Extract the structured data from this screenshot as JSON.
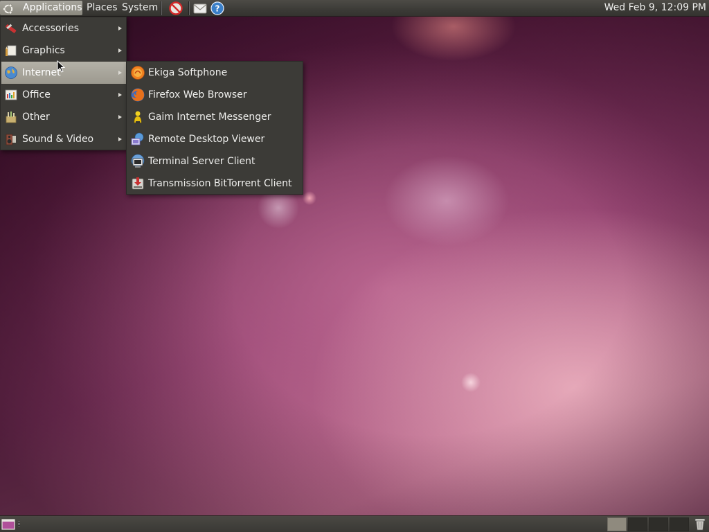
{
  "top_panel": {
    "menus": [
      {
        "label": "Applications"
      },
      {
        "label": "Places"
      },
      {
        "label": "System"
      }
    ],
    "launchers": {
      "disabled": "no-entry-icon",
      "mail": "mail-icon",
      "help": "help-icon"
    },
    "clock": "Wed Feb  9, 12:09 PM"
  },
  "applications_menu": {
    "items": [
      {
        "label": "Accessories",
        "icon": "accessories-icon"
      },
      {
        "label": "Graphics",
        "icon": "graphics-icon"
      },
      {
        "label": "Internet",
        "icon": "internet-icon"
      },
      {
        "label": "Office",
        "icon": "office-icon"
      },
      {
        "label": "Other",
        "icon": "other-icon"
      },
      {
        "label": "Sound & Video",
        "icon": "sound-video-icon"
      }
    ],
    "highlighted": "Internet"
  },
  "internet_submenu": {
    "items": [
      {
        "label": "Ekiga Softphone",
        "icon": "ekiga-icon"
      },
      {
        "label": "Firefox Web Browser",
        "icon": "firefox-icon"
      },
      {
        "label": "Gaim Internet Messenger",
        "icon": "gaim-icon"
      },
      {
        "label": "Remote Desktop Viewer",
        "icon": "remote-desktop-icon"
      },
      {
        "label": "Terminal Server Client",
        "icon": "terminal-server-icon"
      },
      {
        "label": "Transmission BitTorrent Client",
        "icon": "transmission-icon"
      }
    ]
  },
  "bottom_panel": {
    "workspaces": [
      {
        "active": true
      },
      {
        "active": false
      },
      {
        "active": false
      },
      {
        "active": false
      }
    ]
  },
  "colors": {
    "panel": "#3c3b37",
    "menu_bg": "#3c3b37",
    "highlight": "#a8a59b",
    "text": "#eeeeec"
  }
}
